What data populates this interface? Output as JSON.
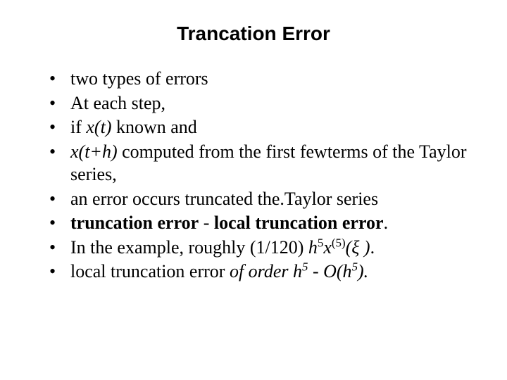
{
  "title": "Trancation Error",
  "bullets": {
    "b1": "two types of errors",
    "b2": "At each step,",
    "b3_pre": "if ",
    "b3_fn": "x(t)",
    "b3_post": " known and",
    "b4_fn": "x(t+h)",
    "b4_post": " computed from the first fewterms of the Taylor series,",
    "b5": "an error occurs truncated the.Taylor series",
    "b6_strong": "truncation error",
    "b6_mid": " - ",
    "b6_strong2": "local truncation error",
    "b6_end": ".",
    "b7_pre": "In the example, roughly (1/120) ",
    "b7_h": "h",
    "b7_sup1": "5",
    "b7_x": "x",
    "b7_sup2": "(5)",
    "b7_paren": "(ξ )",
    "b7_end": ".",
    "b8_pre": "local truncation error ",
    "b8_it": "of order h",
    "b8_sup": "5",
    "b8_mid": " - ",
    "b8_it2": "O(h",
    "b8_sup2": "5",
    "b8_it3": ").",
    "b8_end": ""
  }
}
